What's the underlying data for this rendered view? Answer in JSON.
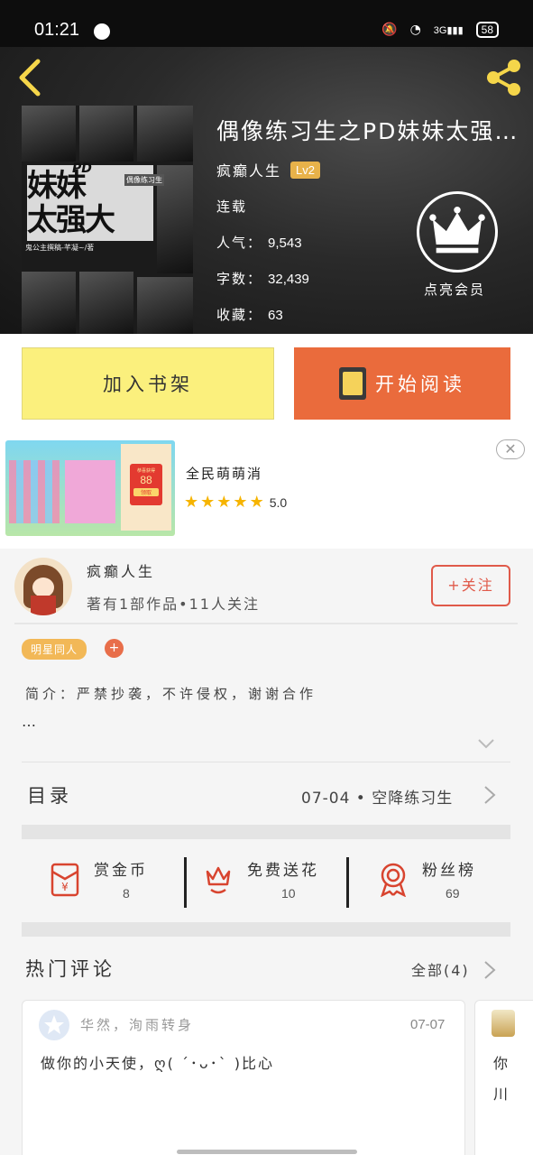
{
  "status_bar": {
    "time": "01:21",
    "battery": "58",
    "network": "3G"
  },
  "book": {
    "title": "偶像练习生之PD妹妹太强…",
    "author": "疯癫人生",
    "level": "Lv2",
    "status": "连载",
    "popularity_label": "人气：",
    "popularity": "9,543",
    "words_label": "字数：",
    "words": "32,439",
    "favorites_label": "收藏：",
    "favorites": "63",
    "vip_label": "点亮会员",
    "cover": {
      "pd": "PD",
      "art_line1": "妹妹",
      "art_line2": "太强大",
      "credit": "鬼公主撰稿-芊凝~/著",
      "seal": "偶像练习生"
    }
  },
  "actions": {
    "shelf_label": "加入书架",
    "read_label": "开始阅读"
  },
  "ad": {
    "title": "全民萌萌消",
    "rating": "5.0",
    "stars": 5,
    "reward": "88",
    "reward_label": "恭喜获得",
    "claim_label": "领取"
  },
  "author_card": {
    "name": "疯癫人生",
    "info": "著有1部作品•11人关注",
    "follow_label": "+关注",
    "tag": "明星同人",
    "tag_add": "+",
    "intro": "简介：严禁抄袭，不许侵权，谢谢合作",
    "ellipsis": "…"
  },
  "toc": {
    "label": "目录",
    "latest": "07-04 • 空降练习生"
  },
  "stats": [
    {
      "label": "赏金币",
      "value": "8"
    },
    {
      "label": "免费送花",
      "value": "10"
    },
    {
      "label": "粉丝榜",
      "value": "69"
    }
  ],
  "comments": {
    "title": "热门评论",
    "all_label": "全部(4)",
    "items": [
      {
        "user": "华然，洵雨转身",
        "date": "07-07",
        "text": "做你的小天使，ღ( ´･ᴗ･` )比心"
      },
      {
        "text1": "你",
        "text2": "川"
      }
    ]
  },
  "colors": {
    "shelf_button": "#fbf07d",
    "read_button": "#ea6b3c",
    "accent_red": "#e05a4a",
    "tag": "#f2b857",
    "header_icon": "#f5d64a"
  }
}
